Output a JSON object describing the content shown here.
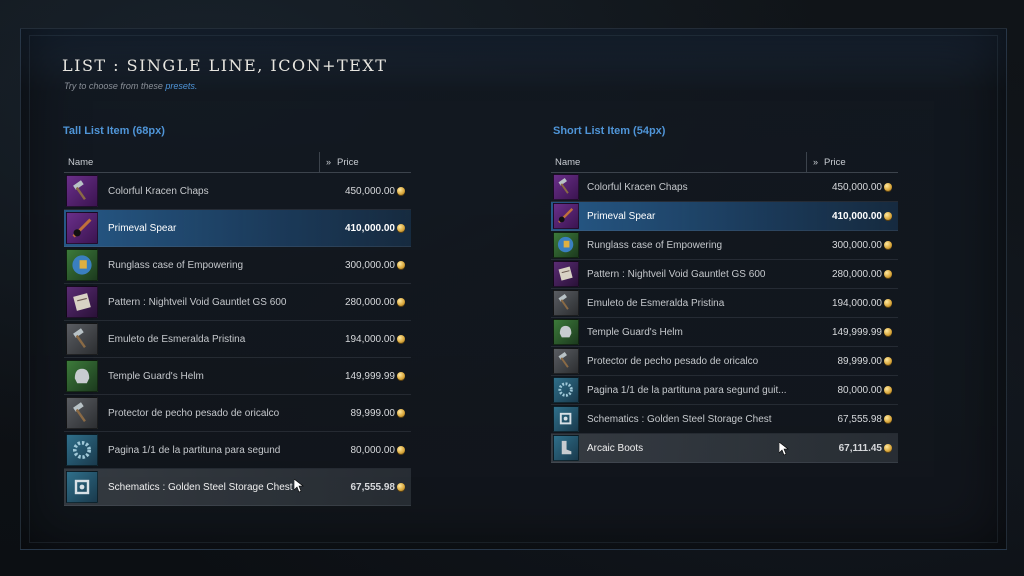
{
  "page": {
    "title": "LIST : SINGLE LINE, ICON+TEXT",
    "subtitle_text": "Try to choose from these",
    "subtitle_link": "presets."
  },
  "tall_list": {
    "section_title": "Tall List Item (68px)",
    "header": {
      "name": "Name",
      "price": "Price"
    },
    "items": [
      {
        "name": "Colorful Kracen Chaps",
        "price": "450,000.00",
        "icon": "hammer-icon",
        "color": "purple"
      },
      {
        "name": "Primeval Spear",
        "price": "410,000.00",
        "icon": "spear-icon",
        "color": "purple",
        "state": "selected"
      },
      {
        "name": "Runglass case of Empowering",
        "price": "300,000.00",
        "icon": "runglass-icon",
        "color": "green"
      },
      {
        "name": "Pattern : Nightveil Void Gauntlet GS 600",
        "price": "280,000.00",
        "icon": "scroll-icon",
        "color": "purple2"
      },
      {
        "name": "Emuleto de Esmeralda Pristina",
        "price": "194,000.00",
        "icon": "hammer-icon",
        "color": "gray"
      },
      {
        "name": "Temple Guard's Helm",
        "price": "149,999.99",
        "icon": "helm-icon",
        "color": "green"
      },
      {
        "name": "Protector de pecho pesado de oricalco",
        "price": "89,999.00",
        "icon": "hammer-icon",
        "color": "gray"
      },
      {
        "name": "Pagina 1/1 de la partituna para segund",
        "price": "80,000.00",
        "icon": "ring-icon",
        "color": "teal"
      },
      {
        "name": "Schematics : Golden Steel Storage Chest",
        "price": "67,555.98",
        "icon": "schematic-icon",
        "color": "teal",
        "state": "hover"
      }
    ]
  },
  "short_list": {
    "section_title": "Short List Item (54px)",
    "header": {
      "name": "Name",
      "price": "Price"
    },
    "items": [
      {
        "name": "Colorful Kracen Chaps",
        "price": "450,000.00",
        "icon": "hammer-icon",
        "color": "purple"
      },
      {
        "name": "Primeval Spear",
        "price": "410,000.00",
        "icon": "spear-icon",
        "color": "purple",
        "state": "selected"
      },
      {
        "name": "Runglass case of Empowering",
        "price": "300,000.00",
        "icon": "runglass-icon",
        "color": "green"
      },
      {
        "name": "Pattern : Nightveil Void Gauntlet GS 600",
        "price": "280,000.00",
        "icon": "scroll-icon",
        "color": "purple2"
      },
      {
        "name": "Emuleto de Esmeralda Pristina",
        "price": "194,000.00",
        "icon": "hammer-icon",
        "color": "gray"
      },
      {
        "name": "Temple Guard's Helm",
        "price": "149,999.99",
        "icon": "helm-icon",
        "color": "green"
      },
      {
        "name": "Protector de pecho pesado de oricalco",
        "price": "89,999.00",
        "icon": "hammer-icon",
        "color": "gray"
      },
      {
        "name": "Pagina 1/1 de la partituna para segund guit...",
        "price": "80,000.00",
        "icon": "ring-icon",
        "color": "teal"
      },
      {
        "name": "Schematics : Golden Steel Storage Chest",
        "price": "67,555.98",
        "icon": "schematic-icon",
        "color": "teal"
      },
      {
        "name": "Arcaic Boots",
        "price": "67,111.45",
        "icon": "boots-icon",
        "color": "teal",
        "state": "hover"
      }
    ]
  },
  "colors": {
    "accent": "#4f95d8",
    "selected_row": "#285f91",
    "coin": "#d9a63a"
  }
}
